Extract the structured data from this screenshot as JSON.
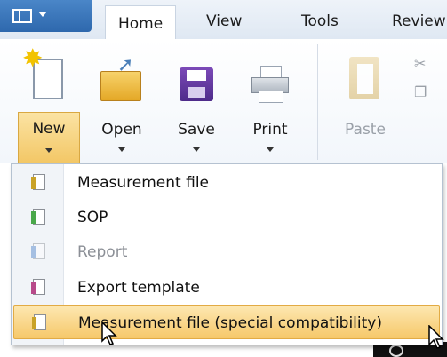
{
  "tabs": [
    {
      "label": "Home"
    },
    {
      "label": "View"
    },
    {
      "label": "Tools"
    },
    {
      "label": "Review"
    }
  ],
  "ribbon": {
    "buttons": [
      {
        "label": "New",
        "icon": "new-document-icon",
        "state": "pressed"
      },
      {
        "label": "Open",
        "icon": "open-folder-icon",
        "state": "enabled"
      },
      {
        "label": "Save",
        "icon": "save-disk-icon",
        "state": "enabled"
      },
      {
        "label": "Print",
        "icon": "printer-icon",
        "state": "enabled"
      },
      {
        "label": "Paste",
        "icon": "paste-icon",
        "state": "disabled"
      }
    ]
  },
  "new_menu": {
    "items": [
      {
        "label": "Measurement file",
        "icon": "measurement-file-icon",
        "accent": "#c9a227",
        "state": "enabled"
      },
      {
        "label": "SOP",
        "icon": "sop-file-icon",
        "accent": "#4aa84a",
        "state": "enabled"
      },
      {
        "label": "Report",
        "icon": "report-file-icon",
        "accent": "#4a80c8",
        "state": "disabled"
      },
      {
        "label": "Export template",
        "icon": "export-template-icon",
        "accent": "#b84a8a",
        "state": "enabled"
      },
      {
        "label": "Measurement file (special compatibility)",
        "icon": "measurement-file-icon",
        "accent": "#c9a227",
        "state": "hover"
      }
    ]
  },
  "colors": {
    "app_button": "#3b78bd",
    "hover_highlight": "#f6c86a"
  }
}
